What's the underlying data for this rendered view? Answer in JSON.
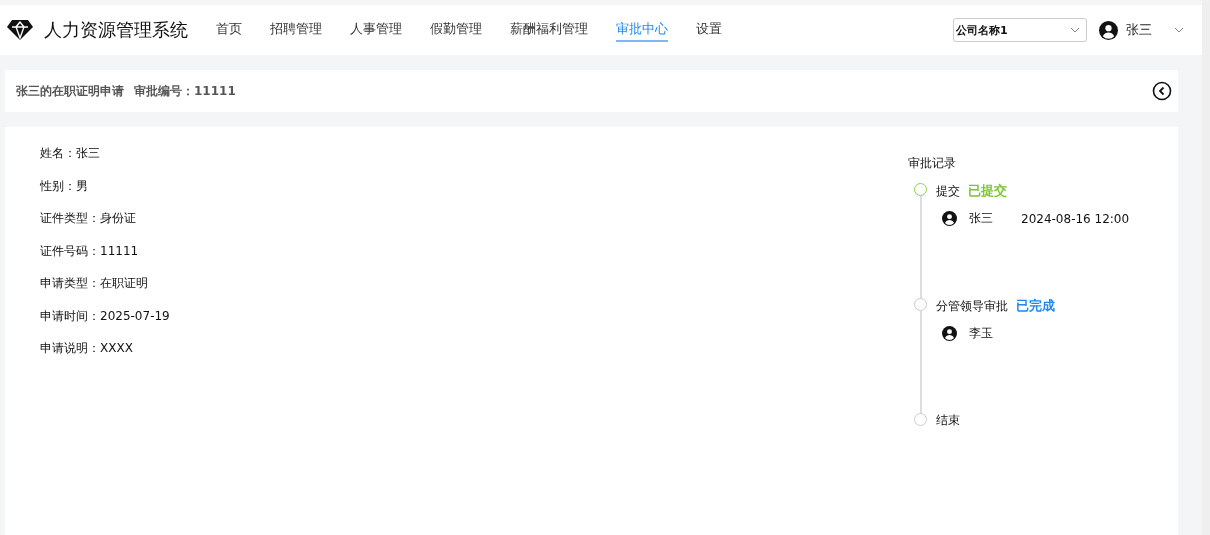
{
  "app": {
    "title": "人力资源管理系统"
  },
  "nav": [
    {
      "label": "首页",
      "selected": false
    },
    {
      "label": "招聘管理",
      "selected": false
    },
    {
      "label": "人事管理",
      "selected": false
    },
    {
      "label": "假勤管理",
      "selected": false
    },
    {
      "label": "薪酬福利管理",
      "selected": false
    },
    {
      "label": "审批中心",
      "selected": true
    },
    {
      "label": "设置",
      "selected": false
    }
  ],
  "company_select": {
    "value": "公司名称1"
  },
  "user": {
    "name": "张三"
  },
  "page_header": {
    "title": "张三的在职证明申请",
    "number_label": "审批编号：11111"
  },
  "fields": [
    {
      "label": "姓名：",
      "value": "张三"
    },
    {
      "label": "性别：",
      "value": "男"
    },
    {
      "label": "证件类型：",
      "value": "身份证"
    },
    {
      "label": "证件号码：",
      "value": "11111"
    },
    {
      "label": "申请类型：",
      "value": "在职证明"
    },
    {
      "label": "申请时间：",
      "value": "2025-07-19"
    },
    {
      "label": "申请说明：",
      "value": "XXXX"
    }
  ],
  "approval_record": {
    "title": "审批记录",
    "steps": [
      {
        "name": "提交",
        "current": true,
        "status": "已提交",
        "color": "#7ec433",
        "person": "张三",
        "time": "2024-08-16 12:00"
      },
      {
        "name": "分管领导审批",
        "current": false,
        "status": "已完成",
        "color": "#1e88f0",
        "person": "李玉"
      },
      {
        "name": "结束",
        "current": false
      }
    ]
  }
}
